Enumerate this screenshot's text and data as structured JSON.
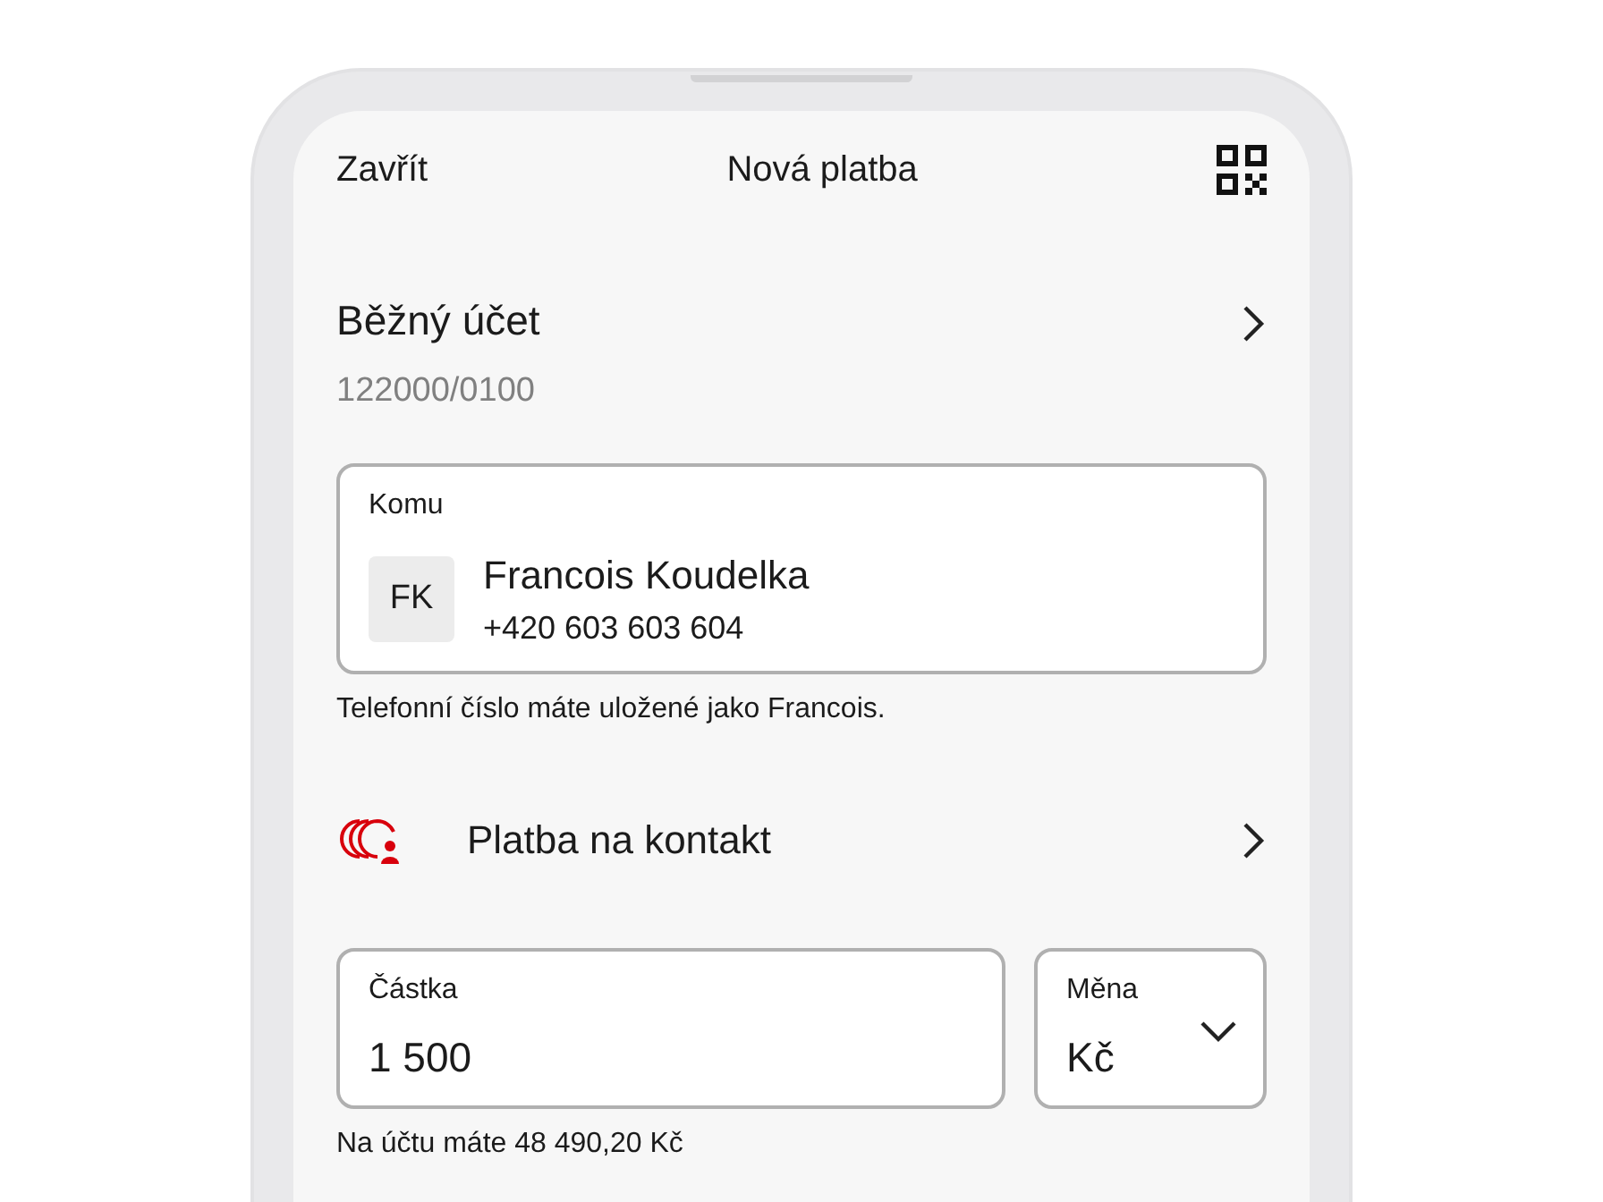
{
  "header": {
    "close": "Zavřít",
    "title": "Nová platba"
  },
  "account": {
    "name": "Běžný účet",
    "number": "122000/0100"
  },
  "recipient": {
    "label": "Komu",
    "initials": "FK",
    "name": "Francois Koudelka",
    "phone": "+420 603 603 604"
  },
  "recipient_note": "Telefonní číslo máte uložené jako Francois.",
  "payment_type": {
    "label": "Platba na kontakt"
  },
  "amount": {
    "label": "Částka",
    "value": "1 500"
  },
  "currency": {
    "label": "Měna",
    "value": "Kč"
  },
  "balance_note": "Na účtu máte 48 490,20 Kč"
}
